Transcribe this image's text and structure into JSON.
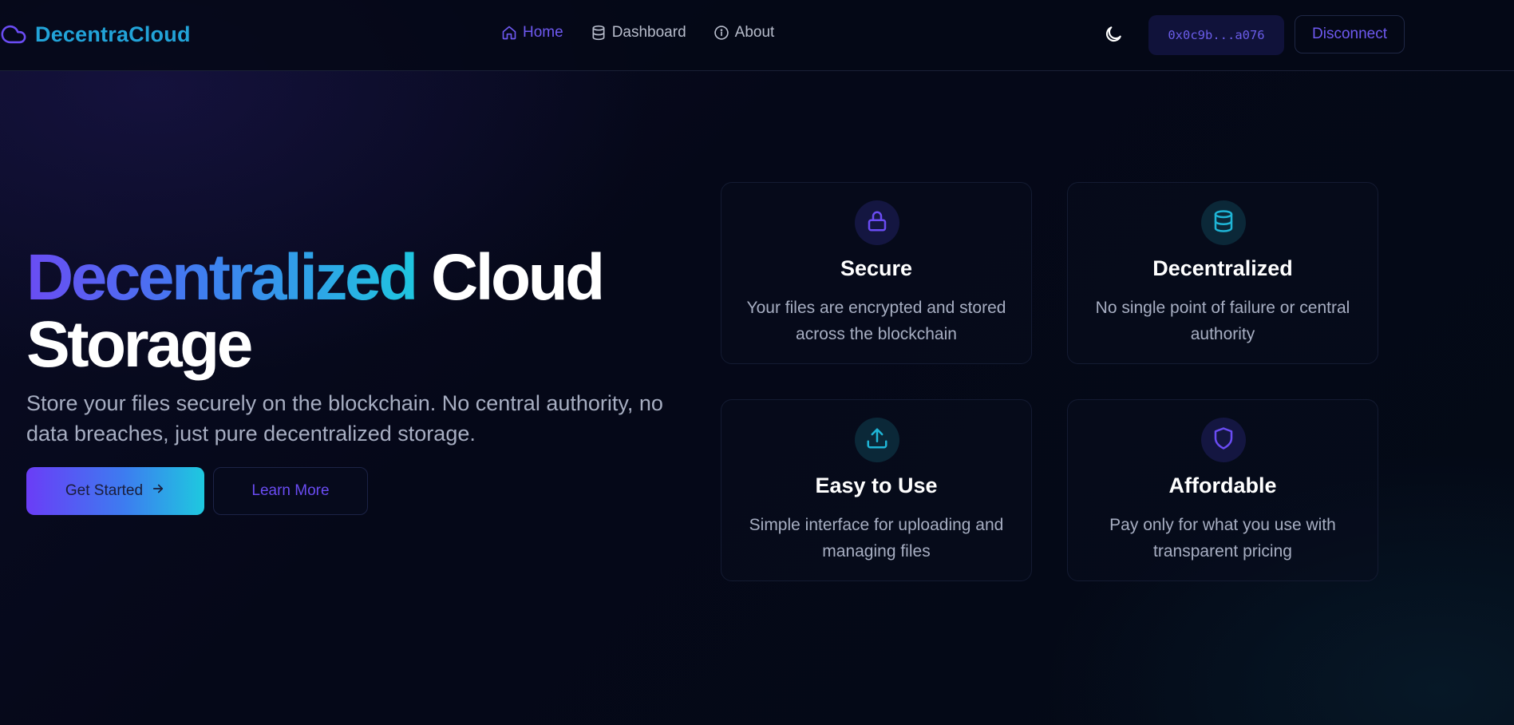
{
  "app": {
    "brand_name": "DecentraCloud",
    "brand_icon": "cloud-icon"
  },
  "nav": {
    "items": [
      {
        "label": "Home",
        "icon": "home-icon",
        "active": true
      },
      {
        "label": "Dashboard",
        "icon": "database-icon",
        "active": false
      },
      {
        "label": "About",
        "icon": "info-icon",
        "active": false
      }
    ]
  },
  "header": {
    "theme_icon": "moon-icon",
    "wallet_address": "0x0c9b...a076",
    "disconnect_label": "Disconnect"
  },
  "hero": {
    "title_highlight": "Decentralized",
    "title_rest": "Cloud Storage",
    "subtitle": "Store your files securely on the blockchain. No central authority, no data breaches, just pure decentralized storage.",
    "primary_button": "Get Started",
    "primary_button_icon": "arrow-right-icon",
    "secondary_button": "Learn More"
  },
  "features": [
    {
      "title": "Secure",
      "description": "Your files are encrypted and stored across the blockchain",
      "icon": "lock-icon",
      "accent": "#6a4cf3"
    },
    {
      "title": "Decentralized",
      "description": "No single point of failure or central authority",
      "icon": "database-icon",
      "accent": "#1fb5d6"
    },
    {
      "title": "Easy to Use",
      "description": "Simple interface for uploading and managing files",
      "icon": "upload-icon",
      "accent": "#1fb5d6"
    },
    {
      "title": "Affordable",
      "description": "Pay only for what you use with transparent pricing",
      "icon": "shield-icon",
      "accent": "#6a4cf3"
    }
  ],
  "colors": {
    "background": "#050916",
    "accent_purple": "#6a4cf3",
    "accent_cyan": "#1fc6df",
    "text_muted": "#a7aec2"
  }
}
